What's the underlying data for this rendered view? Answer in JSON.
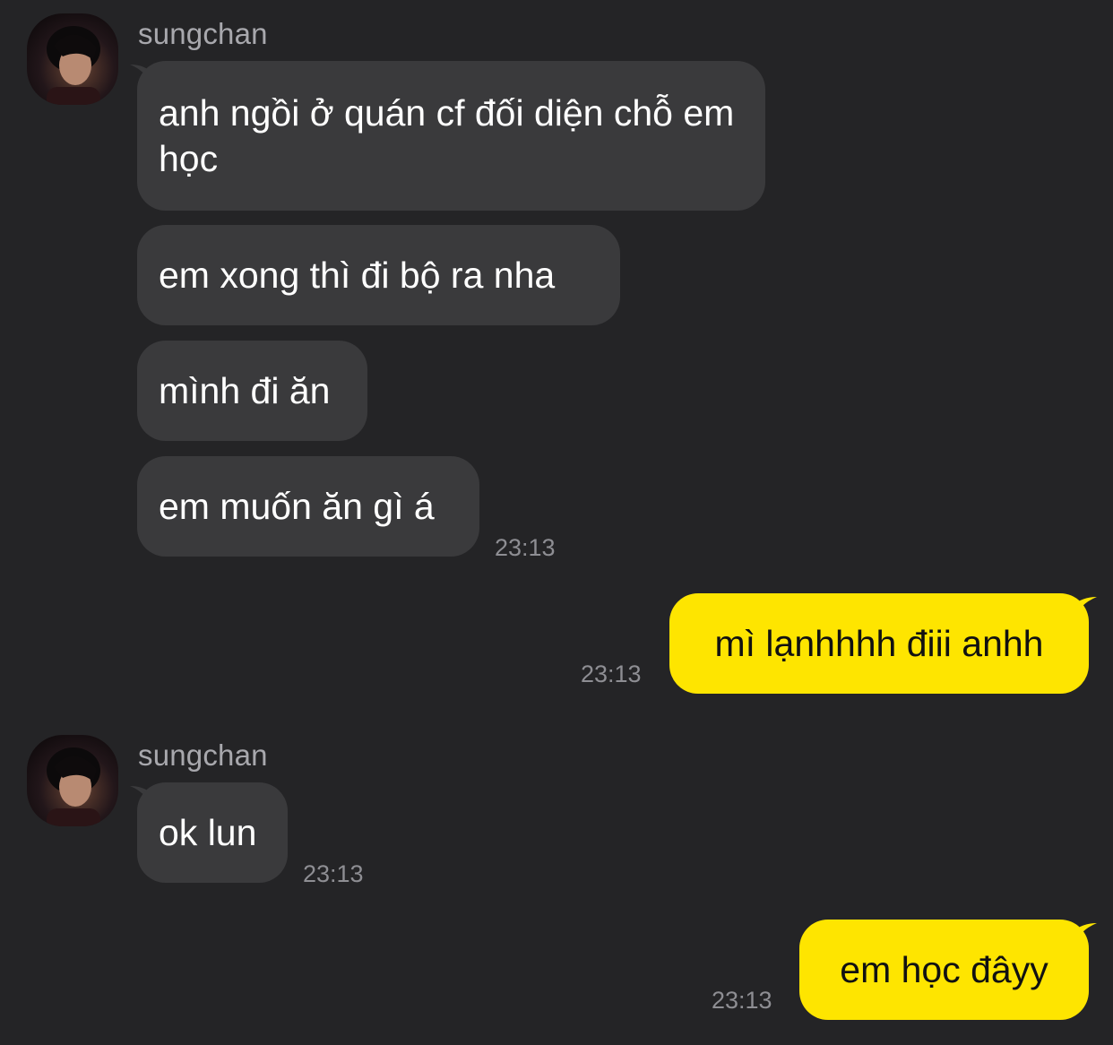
{
  "chat": {
    "contact_name": "sungchan",
    "groups": [
      {
        "sender": "sungchan",
        "messages": [
          "anh ngồi ở quán cf đối diện chỗ em học",
          "em xong thì đi bộ ra nha",
          "mình đi ăn",
          "em muốn ăn gì á"
        ],
        "time": "23:13"
      },
      {
        "sender": "me",
        "messages": [
          "mì lạnhhhh điii anhh"
        ],
        "time": "23:13"
      },
      {
        "sender": "sungchan",
        "messages": [
          "ok lun"
        ],
        "time": "23:13"
      },
      {
        "sender": "me",
        "messages": [
          "em học đâyy"
        ],
        "time": "23:13"
      }
    ]
  },
  "colors": {
    "background": "#242426",
    "incoming_bubble": "#3a3a3c",
    "outgoing_bubble": "#fee500",
    "timestamp": "#8e8e93",
    "sender_name": "#a8a8ad"
  },
  "icons": {
    "avatar": "contact-avatar-photo"
  }
}
